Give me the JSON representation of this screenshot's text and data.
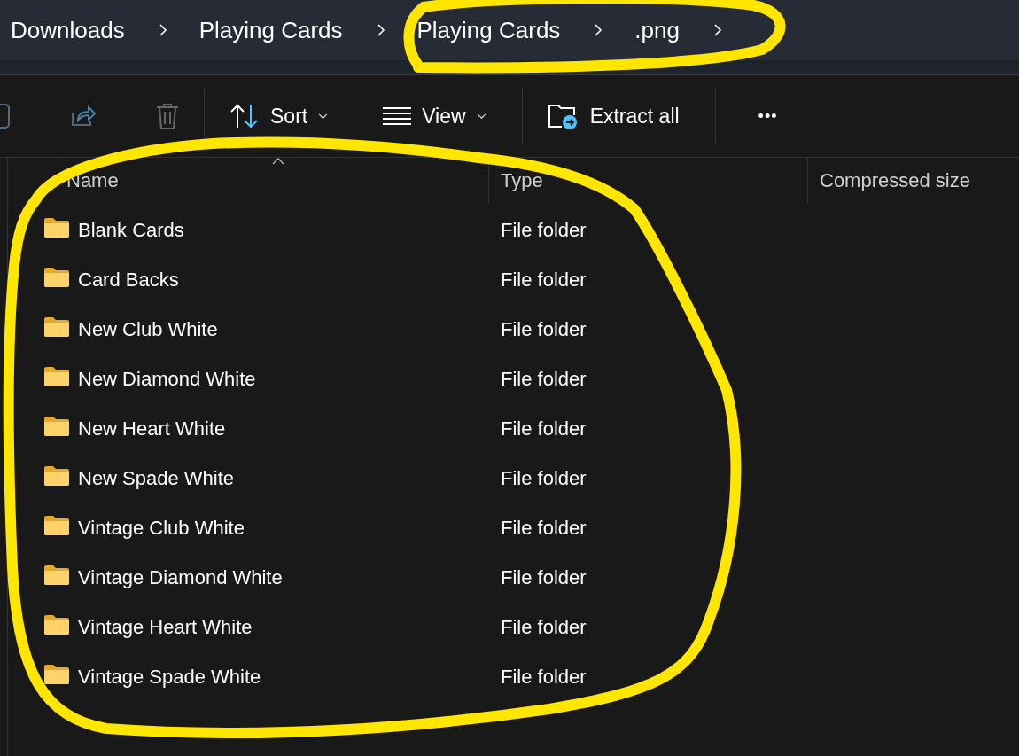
{
  "breadcrumb": [
    {
      "label": "Downloads"
    },
    {
      "label": "Playing Cards"
    },
    {
      "label": "Playing Cards"
    },
    {
      "label": ".png"
    }
  ],
  "toolbar": {
    "sort": "Sort",
    "view": "View",
    "extract": "Extract all",
    "more": "•••"
  },
  "columns": [
    {
      "label": "Name",
      "sorted": true
    },
    {
      "label": "Type",
      "sorted": false
    },
    {
      "label": "Compressed size",
      "sorted": false
    }
  ],
  "rows": [
    {
      "name": "Blank Cards",
      "type": "File folder"
    },
    {
      "name": "Card Backs",
      "type": "File folder"
    },
    {
      "name": "New Club White",
      "type": "File folder"
    },
    {
      "name": "New Diamond White",
      "type": "File folder"
    },
    {
      "name": "New Heart White",
      "type": "File folder"
    },
    {
      "name": "New Spade White",
      "type": "File folder"
    },
    {
      "name": "Vintage Club White",
      "type": "File folder"
    },
    {
      "name": "Vintage Diamond White",
      "type": "File folder"
    },
    {
      "name": "Vintage Heart White",
      "type": "File folder"
    },
    {
      "name": "Vintage Spade White",
      "type": "File folder"
    }
  ]
}
